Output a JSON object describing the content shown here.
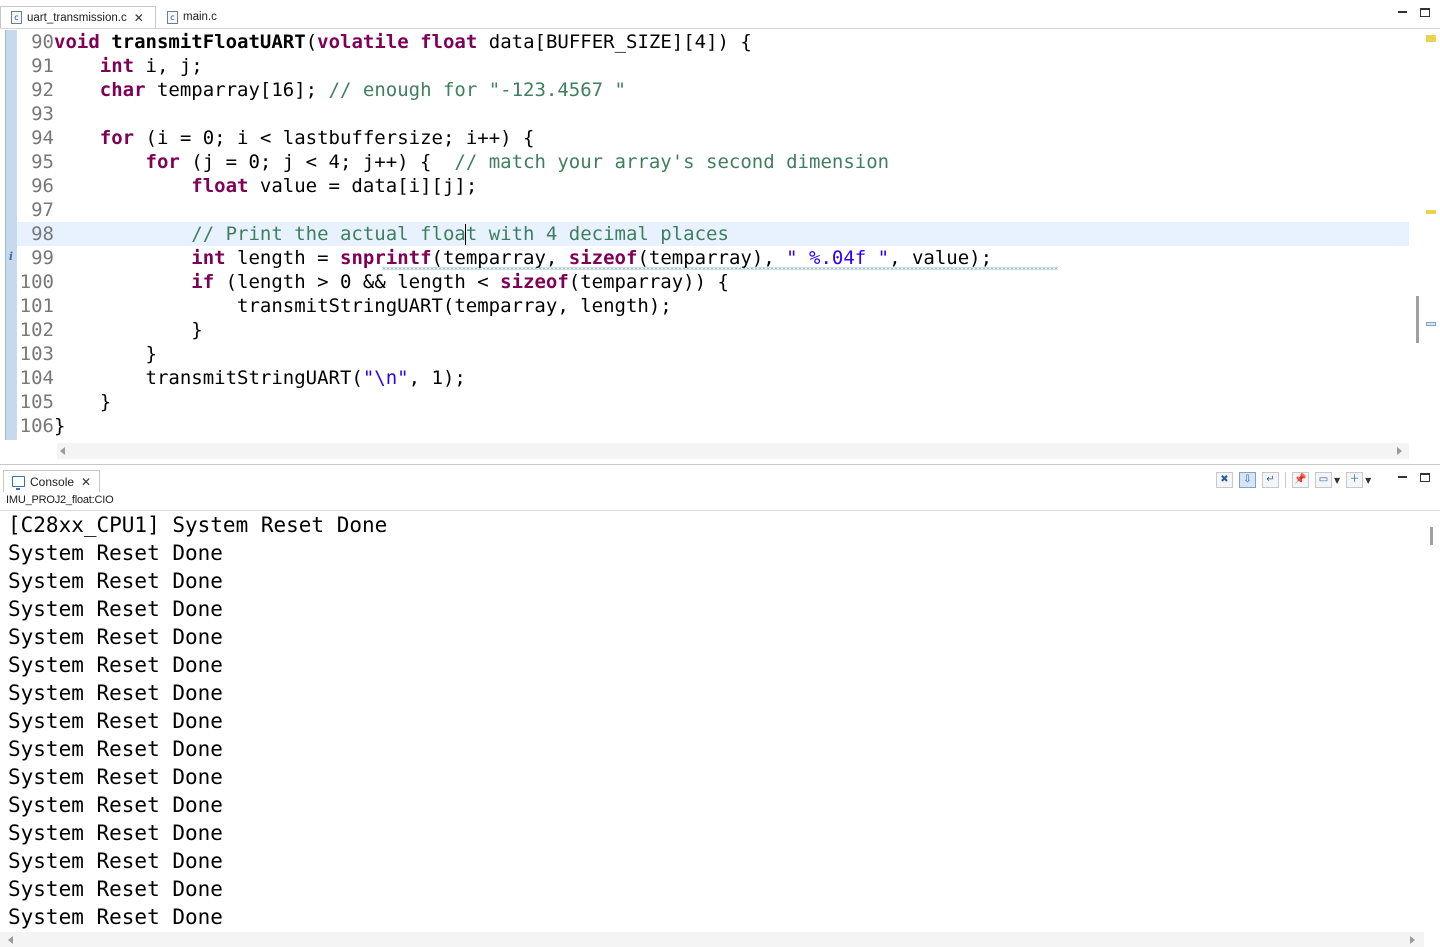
{
  "editor": {
    "tabs": [
      {
        "label": "uart_transmission.c",
        "active": true
      },
      {
        "label": "main.c",
        "active": false
      }
    ],
    "close_glyph": "✕",
    "file_icon_glyph": "c",
    "info_marker": "i"
  },
  "code_lines": [
    {
      "no": "90",
      "tokens": [
        {
          "t": "void",
          "c": "kw"
        },
        {
          "t": " "
        },
        {
          "t": "transmitFloatUART",
          "c": "fn"
        },
        {
          "t": "("
        },
        {
          "t": "volatile",
          "c": "kw"
        },
        {
          "t": " "
        },
        {
          "t": "float",
          "c": "kw"
        },
        {
          "t": " data[BUFFER_SIZE][4]) {"
        }
      ]
    },
    {
      "no": "91",
      "tokens": [
        {
          "t": "    "
        },
        {
          "t": "int",
          "c": "kw"
        },
        {
          "t": " i, j;"
        }
      ]
    },
    {
      "no": "92",
      "tokens": [
        {
          "t": "    "
        },
        {
          "t": "char",
          "c": "kw"
        },
        {
          "t": " temparray[16]; "
        },
        {
          "t": "// enough for \"-123.4567 \"",
          "c": "cm"
        }
      ]
    },
    {
      "no": "93",
      "tokens": []
    },
    {
      "no": "94",
      "tokens": [
        {
          "t": "    "
        },
        {
          "t": "for",
          "c": "kw"
        },
        {
          "t": " (i = 0; i < lastbuffersize; i++) {"
        }
      ]
    },
    {
      "no": "95",
      "tokens": [
        {
          "t": "        "
        },
        {
          "t": "for",
          "c": "kw"
        },
        {
          "t": " (j = 0; j < 4; j++) {  "
        },
        {
          "t": "// match your array's second dimension",
          "c": "cm"
        }
      ]
    },
    {
      "no": "96",
      "tokens": [
        {
          "t": "            "
        },
        {
          "t": "float",
          "c": "kw"
        },
        {
          "t": " value = data[i][j];"
        }
      ]
    },
    {
      "no": "97",
      "tokens": []
    },
    {
      "no": "98",
      "current": true,
      "tokens": [
        {
          "t": "            "
        },
        {
          "t": "// Print the actual floa",
          "c": "cm"
        },
        {
          "cursor": true
        },
        {
          "t": "t with 4 decimal places",
          "c": "cm"
        }
      ]
    },
    {
      "no": "99",
      "squiggle": true,
      "tokens": [
        {
          "t": "            "
        },
        {
          "t": "int",
          "c": "kw"
        },
        {
          "t": " length = "
        },
        {
          "t": "snprintf",
          "c": "kw"
        },
        {
          "t": "(temparray, "
        },
        {
          "t": "sizeof",
          "c": "kw"
        },
        {
          "t": "(temparray), "
        },
        {
          "t": "\" %.04f \"",
          "c": "st"
        },
        {
          "t": ", value);"
        }
      ]
    },
    {
      "no": "100",
      "tokens": [
        {
          "t": "            "
        },
        {
          "t": "if",
          "c": "kw"
        },
        {
          "t": " (length > 0 && length < "
        },
        {
          "t": "sizeof",
          "c": "kw"
        },
        {
          "t": "(temparray)) {"
        }
      ]
    },
    {
      "no": "101",
      "tokens": [
        {
          "t": "                transmitStringUART(temparray, length);"
        }
      ]
    },
    {
      "no": "102",
      "tokens": [
        {
          "t": "            }"
        }
      ]
    },
    {
      "no": "103",
      "tokens": [
        {
          "t": "        }"
        }
      ]
    },
    {
      "no": "104",
      "tokens": [
        {
          "t": "        transmitStringUART("
        },
        {
          "t": "\"\\n\"",
          "c": "st"
        },
        {
          "t": ", 1);"
        }
      ]
    },
    {
      "no": "105",
      "tokens": [
        {
          "t": "    }"
        }
      ]
    },
    {
      "no": "106",
      "tokens": [
        {
          "t": "}"
        }
      ]
    }
  ],
  "console": {
    "tab_label": "Console",
    "close_glyph": "✕",
    "label": "IMU_PROJ2_float:CIO",
    "toolbar": {
      "clear": "✖",
      "scroll_lock": "⇩",
      "word_wrap": "↵",
      "pin": "📌",
      "display": "▭",
      "open": "＋",
      "dropdown": "▼"
    },
    "output": [
      "[C28xx_CPU1] System Reset Done",
      "System Reset Done",
      "System Reset Done",
      "System Reset Done",
      "System Reset Done",
      "System Reset Done",
      "System Reset Done",
      "System Reset Done",
      "System Reset Done",
      "System Reset Done",
      "System Reset Done",
      "System Reset Done",
      "System Reset Done",
      "System Reset Done",
      "System Reset Done"
    ]
  },
  "icons": {
    "c_file": "c-file-icon",
    "console": "console-icon",
    "minimize": "minimize-icon",
    "maximize": "maximize-icon"
  },
  "colors": {
    "keyword": "#7f0055",
    "comment": "#3f7f5f",
    "string": "#2a00ff",
    "line_number": "#787878",
    "current_line": "#e8f2fe",
    "left_ruler": "#c7d9ec"
  }
}
